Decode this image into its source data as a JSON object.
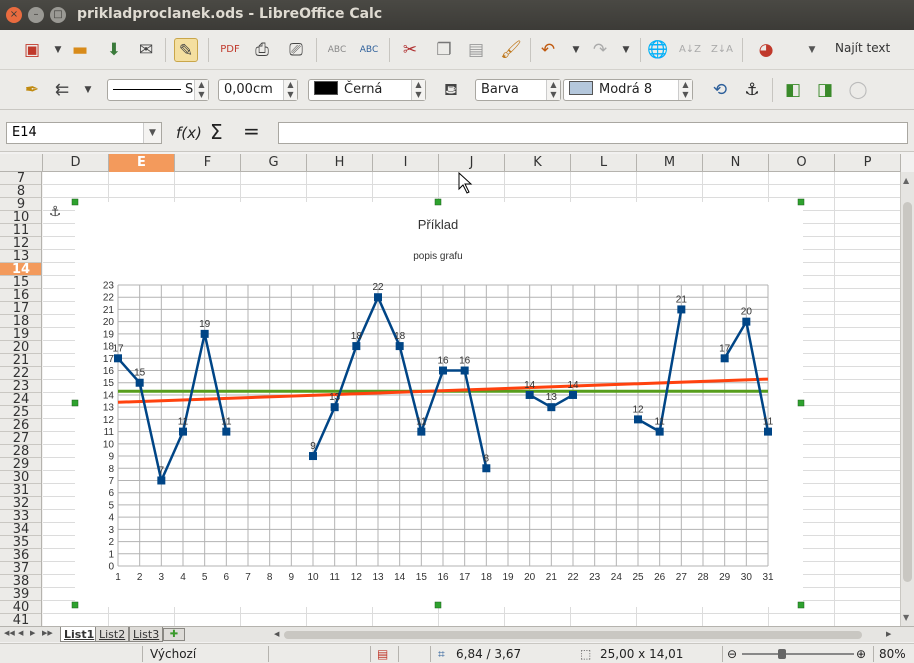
{
  "window": {
    "title": "prikladproclanek.ods - LibreOffice Calc",
    "controls": {
      "close": "×",
      "minimize": "–",
      "maximize": "□"
    }
  },
  "toolbar_standard": {
    "icons": [
      "new-document-icon",
      "open-folder-icon",
      "save-icon",
      "mail-icon",
      "edit-mode-icon",
      "export-pdf-icon",
      "print-icon",
      "print-preview-icon",
      "spellcheck-icon",
      "autospellcheck-icon",
      "cut-icon",
      "copy-icon",
      "paste-icon",
      "clone-formatting-icon",
      "undo-icon",
      "redo-icon",
      "hyperlink-icon",
      "sort-ascending-icon",
      "sort-descending-icon",
      "chart-icon"
    ],
    "find_label": "Najít text"
  },
  "toolbar_drawing": {
    "line_style_value": "S",
    "line_width_value": "0,00cm",
    "line_color_value": "Černá",
    "line_color_hex": "#000000",
    "area_style_value": "Barva",
    "area_color_value": "Modrá 8",
    "area_color_hex": "#b4c7dc"
  },
  "formula_bar": {
    "name_box": "E14",
    "fx_label": "f(x)",
    "sum_label": "Σ",
    "equals_label": "=",
    "formula": ""
  },
  "sheet": {
    "columns": [
      "D",
      "E",
      "F",
      "G",
      "H",
      "I",
      "J",
      "K",
      "L",
      "M",
      "N",
      "O",
      "P"
    ],
    "active_column": "E",
    "rows": [
      "7",
      "8",
      "9",
      "10",
      "11",
      "12",
      "13",
      "14",
      "15",
      "16",
      "17",
      "18",
      "19",
      "20",
      "21",
      "22",
      "23",
      "24",
      "25",
      "26",
      "27",
      "28",
      "29",
      "30",
      "31",
      "32",
      "33",
      "34",
      "35",
      "36",
      "37",
      "38",
      "39",
      "40",
      "41"
    ],
    "active_row": "14"
  },
  "chart_data": {
    "type": "line",
    "title": "Příklad",
    "subtitle": "popis grafu",
    "xlabel": "",
    "ylabel": "",
    "ylim": [
      0,
      23
    ],
    "grid": true,
    "categories": [
      1,
      2,
      3,
      4,
      5,
      6,
      7,
      8,
      9,
      10,
      11,
      12,
      13,
      14,
      15,
      16,
      17,
      18,
      19,
      20,
      21,
      22,
      23,
      24,
      25,
      26,
      27,
      28,
      29,
      30,
      31
    ],
    "series": [
      {
        "values": [
          17,
          15,
          7,
          11,
          19,
          11,
          null,
          null,
          null,
          9,
          13,
          18,
          22,
          18,
          11,
          16,
          16,
          8,
          null,
          14,
          13,
          14,
          null,
          null,
          12,
          11,
          21,
          null,
          17,
          20,
          11
        ],
        "color": "#004586",
        "marker": "square",
        "data_labels": true
      },
      {
        "type": "mean-line",
        "values": [
          14.3,
          14.3
        ],
        "color": "#579d1c"
      },
      {
        "type": "trend-line",
        "values": [
          13.4,
          15.3
        ],
        "color": "#ff420e"
      }
    ]
  },
  "sheet_tabs": [
    "List1",
    "List2",
    "List3"
  ],
  "active_tab": "List1",
  "statusbar": {
    "page_style": "Výchozí",
    "position": "6,84 / 3,67",
    "size": "25,00 x 14,01",
    "zoom": "80%"
  }
}
